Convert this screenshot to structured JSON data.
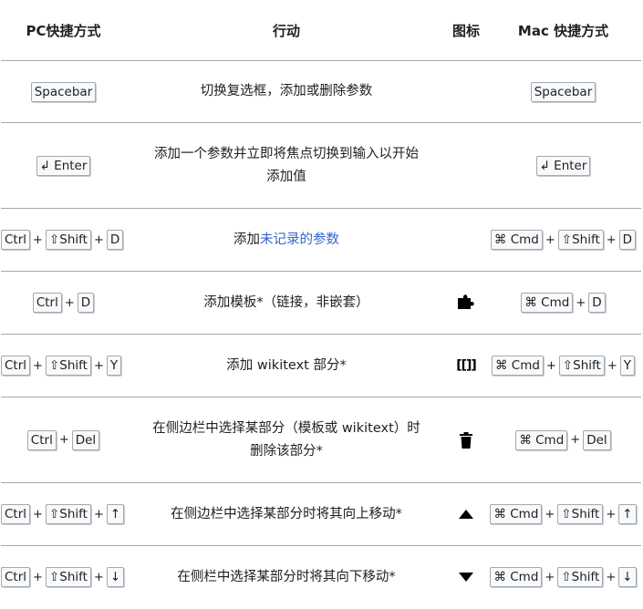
{
  "headers": {
    "pc": "PC快捷方式",
    "action": "行动",
    "icon": "图标",
    "mac": "Mac 快捷方式"
  },
  "rows": [
    {
      "pc": [
        "Spacebar"
      ],
      "action": "切换复选框，添加或删除参数",
      "icon": "",
      "mac": [
        "Spacebar"
      ]
    },
    {
      "pc": [
        "↲ Enter"
      ],
      "action_line1": "添加一个参数并立即将焦点切换到输入以开始",
      "action_line2": "添加值",
      "icon": "",
      "mac": [
        "↲ Enter"
      ]
    },
    {
      "pc": [
        "Ctrl",
        "⇧Shift",
        "D"
      ],
      "action_prefix": "添加",
      "action_link": "未记录的参数",
      "icon": "",
      "mac": [
        "⌘ Cmd",
        "⇧Shift",
        "D"
      ]
    },
    {
      "pc": [
        "Ctrl",
        "D"
      ],
      "action": "添加模板*（链接，非嵌套）",
      "icon": "puzzle-icon",
      "mac": [
        "⌘ Cmd",
        "D"
      ]
    },
    {
      "pc": [
        "Ctrl",
        "⇧Shift",
        "Y"
      ],
      "action": "添加 wikitext 部分*",
      "icon": "wikitext-icon",
      "icon_text": "[[]]",
      "mac": [
        "⌘ Cmd",
        "⇧Shift",
        "Y"
      ]
    },
    {
      "pc": [
        "Ctrl",
        "Del"
      ],
      "action_line1": "在侧边栏中选择某部分（模板或 wikitext）时",
      "action_line2": "删除该部分*",
      "icon": "trash-icon",
      "mac": [
        "⌘ Cmd",
        "Del"
      ]
    },
    {
      "pc": [
        "Ctrl",
        "⇧Shift",
        "↑"
      ],
      "action": "在侧边栏中选择某部分时将其向上移动*",
      "icon": "triangle-up-icon",
      "mac": [
        "⌘ Cmd",
        "⇧Shift",
        "↑"
      ]
    },
    {
      "pc": [
        "Ctrl",
        "⇧Shift",
        "↓"
      ],
      "action": "在侧栏中选择某部分时将其向下移动*",
      "icon": "triangle-down-icon",
      "mac": [
        "⌘ Cmd",
        "⇧Shift",
        "↓"
      ]
    }
  ],
  "plus_sign": "+",
  "colors": {
    "link": "#3366cc",
    "border": "#a2a9b1",
    "kbd_bg": "#f8f9fa"
  }
}
